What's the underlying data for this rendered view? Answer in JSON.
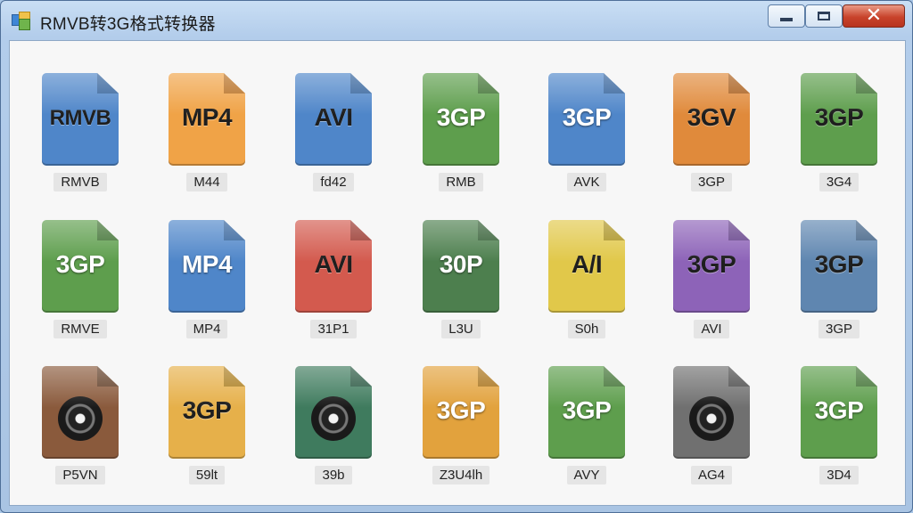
{
  "window": {
    "title": "RMVB转3G格式转换器"
  },
  "controls": {
    "minimize_icon": "minimize-icon",
    "maximize_icon": "maximize-icon",
    "close_glyph": "✕"
  },
  "files": [
    {
      "label": "RMVB",
      "caption": "RMVB",
      "color": "#4f86c9",
      "fold": "#2f5f99",
      "dark": true
    },
    {
      "label": "MP4",
      "caption": "M44",
      "color": "#f0a347",
      "fold": "#b56c1e",
      "dark": true
    },
    {
      "label": "AVI",
      "caption": "fd42",
      "color": "#4f86c9",
      "fold": "#2f5f99",
      "dark": true
    },
    {
      "label": "3GP",
      "caption": "RMB",
      "color": "#5e9e4d",
      "fold": "#3c6f2f",
      "dark": false
    },
    {
      "label": "3GP",
      "caption": "AVK",
      "color": "#4f86c9",
      "fold": "#2f5f99",
      "dark": false
    },
    {
      "label": "3GV",
      "caption": "3GP",
      "color": "#e08a3b",
      "fold": "#a75a16",
      "dark": true
    },
    {
      "label": "3GP",
      "caption": "3G4",
      "color": "#5e9e4d",
      "fold": "#3c6f2f",
      "dark": true
    },
    {
      "label": "3GP",
      "caption": "RMVE",
      "color": "#5e9e4d",
      "fold": "#3c6f2f",
      "dark": false
    },
    {
      "label": "MP4",
      "caption": "MP4",
      "color": "#4f86c9",
      "fold": "#2f5f99",
      "dark": false
    },
    {
      "label": "AVI",
      "caption": "31P1",
      "color": "#d35a4e",
      "fold": "#963229",
      "dark": true
    },
    {
      "label": "30P",
      "caption": "L3U",
      "color": "#4d7f4e",
      "fold": "#2f5a30",
      "dark": false
    },
    {
      "label": "A/I",
      "caption": "S0h",
      "color": "#e1c84a",
      "fold": "#a88f1c",
      "dark": true
    },
    {
      "label": "3GP",
      "caption": "AVI",
      "color": "#8d63b8",
      "fold": "#5f3a86",
      "dark": true
    },
    {
      "label": "3GP",
      "caption": "3GP",
      "color": "#5f86b0",
      "fold": "#3b5d82",
      "dark": true
    },
    {
      "label": "",
      "caption": "P5VN",
      "color": "#8a5a3c",
      "fold": "#5e3a22",
      "dark": false,
      "disc": true
    },
    {
      "label": "3GP",
      "caption": "59lt",
      "color": "#e6b04a",
      "fold": "#a97b1c",
      "dark": true
    },
    {
      "label": "",
      "caption": "39b",
      "color": "#3f7b5e",
      "fold": "#25543e",
      "dark": false,
      "disc": true
    },
    {
      "label": "3GP",
      "caption": "Z3U4lh",
      "color": "#e2a23d",
      "fold": "#a66f14",
      "dark": false
    },
    {
      "label": "3GP",
      "caption": "AVY",
      "color": "#5e9e4d",
      "fold": "#3c6f2f",
      "dark": false
    },
    {
      "label": "",
      "caption": "AG4",
      "color": "#707070",
      "fold": "#474747",
      "dark": false,
      "disc": true
    },
    {
      "label": "3GP",
      "caption": "3D4",
      "color": "#5e9e4d",
      "fold": "#3c6f2f",
      "dark": false
    }
  ]
}
